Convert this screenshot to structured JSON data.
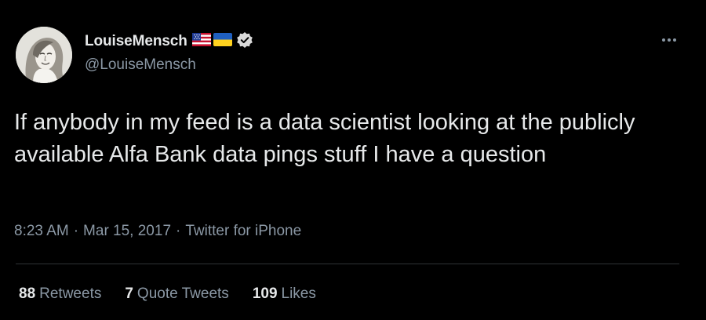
{
  "author": {
    "display_name": "LouiseMensch",
    "handle": "@LouiseMensch",
    "flags": [
      "us-flag-icon",
      "ukraine-flag-icon"
    ],
    "verified": true
  },
  "tweet": {
    "text": "If anybody in my feed is a data scientist looking at the publicly available Alfa Bank data pings stuff I have a question"
  },
  "meta": {
    "time": "8:23 AM",
    "separator": "·",
    "date": "Mar 15, 2017",
    "source": "Twitter for iPhone"
  },
  "stats": {
    "retweets_count": "88",
    "retweets_label": "Retweets",
    "quote_count": "7",
    "quote_label": "Quote Tweets",
    "likes_count": "109",
    "likes_label": "Likes"
  },
  "colors": {
    "background": "#000000",
    "primary_text": "#e7e9ea",
    "secondary_text": "#8b98a5",
    "divider": "#2f3336",
    "verified_badge": "#d9d9d9"
  }
}
